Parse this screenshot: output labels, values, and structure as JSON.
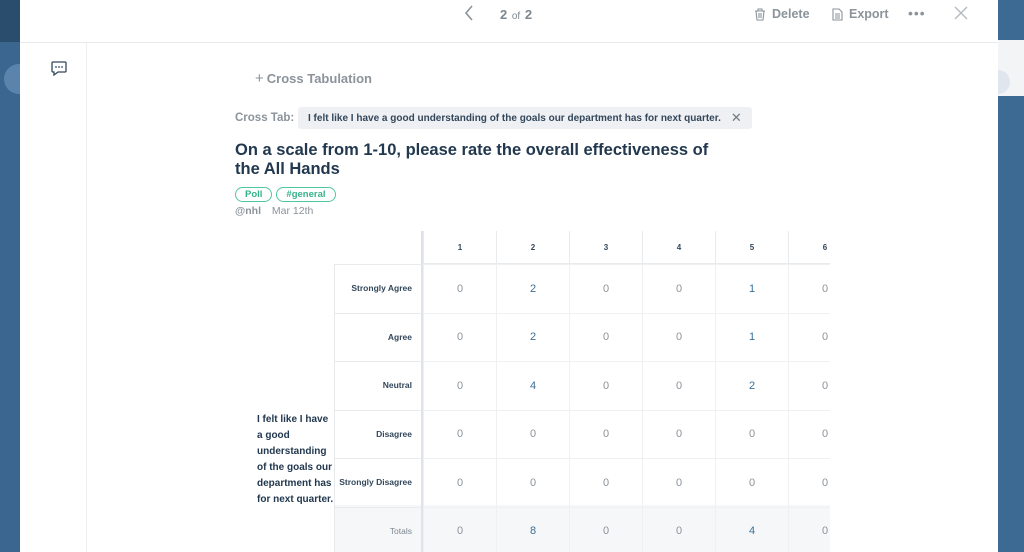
{
  "pager": {
    "current": "2",
    "of": "of",
    "total": "2"
  },
  "actions": {
    "delete": "Delete",
    "export": "Export",
    "more": "•••"
  },
  "cross_tab_button": "Cross Tabulation",
  "cross_tab": {
    "label": "Cross Tab:",
    "chip": "I felt like I have a good understanding of the goals our department has for next quarter."
  },
  "question": {
    "title": "On a scale from 1-10, please rate the overall effectiveness of the All Hands",
    "tags": [
      "Poll",
      "#general"
    ],
    "user": "@nhl",
    "date": "Mar 12th"
  },
  "table": {
    "row_question": "I felt like I have a good understanding of the goals our department has for next quarter.",
    "columns": [
      "1",
      "2",
      "3",
      "4",
      "5",
      "6"
    ],
    "rows": [
      {
        "label": "Strongly Agree",
        "values": [
          "0",
          "2",
          "0",
          "0",
          "1",
          "0"
        ]
      },
      {
        "label": "Agree",
        "values": [
          "0",
          "2",
          "0",
          "0",
          "1",
          "0"
        ]
      },
      {
        "label": "Neutral",
        "values": [
          "0",
          "4",
          "0",
          "0",
          "2",
          "0"
        ]
      },
      {
        "label": "Disagree",
        "values": [
          "0",
          "0",
          "0",
          "0",
          "0",
          "0"
        ]
      },
      {
        "label": "Strongly Disagree",
        "values": [
          "0",
          "0",
          "0",
          "0",
          "0",
          "0"
        ]
      },
      {
        "label": "Totals",
        "values": [
          "0",
          "8",
          "0",
          "0",
          "4",
          "0"
        ]
      }
    ]
  },
  "colors": {
    "accent_green": "#36b28b",
    "title": "#22384f",
    "muted": "#8b939b",
    "value": "#3a6f96"
  }
}
